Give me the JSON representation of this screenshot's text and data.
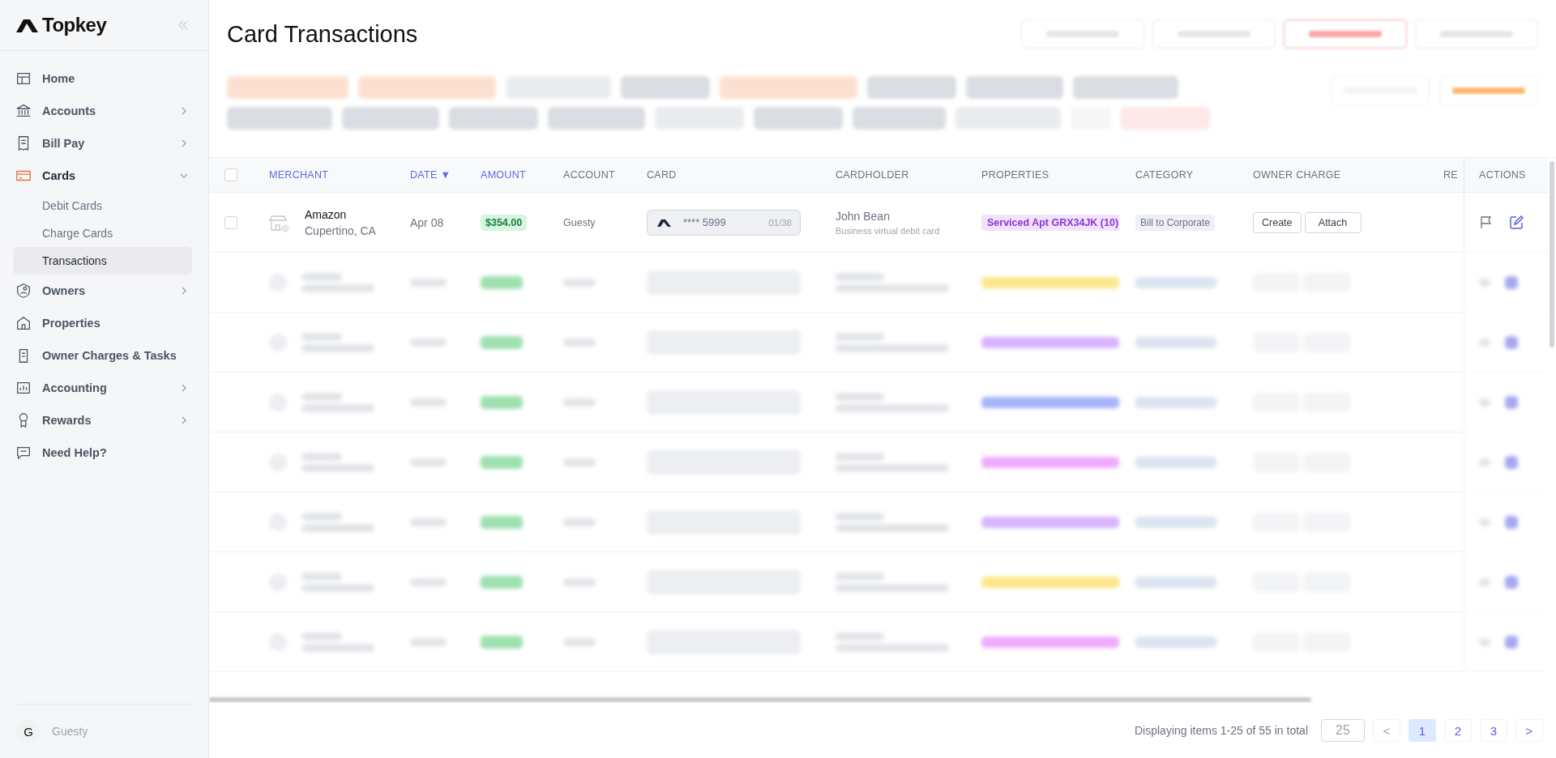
{
  "sidebar": {
    "logo": "Topkey",
    "items": [
      {
        "label": "Home",
        "active": false
      },
      {
        "label": "Accounts",
        "active": false,
        "expanded": false
      },
      {
        "label": "Bill Pay",
        "active": false,
        "expanded": false
      },
      {
        "label": "Cards",
        "active": true,
        "expanded": true,
        "children": [
          {
            "label": "Debit Cards",
            "selected": false
          },
          {
            "label": "Charge Cards",
            "selected": false
          },
          {
            "label": "Transactions",
            "selected": true
          }
        ]
      },
      {
        "label": "Owners",
        "active": false,
        "expanded": false
      },
      {
        "label": "Properties",
        "active": false
      },
      {
        "label": "Owner Charges & Tasks",
        "active": false
      },
      {
        "label": "Accounting",
        "active": false,
        "expanded": false
      },
      {
        "label": "Rewards",
        "active": false,
        "expanded": false
      },
      {
        "label": "Need Help?",
        "active": false
      }
    ],
    "account": {
      "avatar": "G",
      "name": "Guesty"
    }
  },
  "page": {
    "title": "Card Transactions",
    "header_actions": [
      {
        "color": "#e5e7eb"
      },
      {
        "color": "#e5e7eb"
      },
      {
        "color": "#fca5a5"
      },
      {
        "color": "#e5e7eb"
      }
    ],
    "filter_chips": [
      {
        "color": "#fcd9c4"
      },
      {
        "color": "#fcd9c4"
      },
      {
        "color": "#e5e7eb"
      },
      {
        "color": "#d1d5db"
      },
      {
        "color": "#fcd9c4"
      },
      {
        "color": "#d1d5db"
      },
      {
        "color": "#d1d5db"
      },
      {
        "color": "#d1d5db"
      },
      {
        "color": "#d1d5db"
      },
      {
        "color": "#d1d5db"
      },
      {
        "color": "#d1d5db"
      },
      {
        "color": "#d1d5db"
      },
      {
        "color": "#e5e7eb"
      },
      {
        "color": "#d1d5db"
      },
      {
        "color": "#d1d5db"
      },
      {
        "color": "#e5e7eb"
      },
      {
        "color": "#f3f4f6"
      },
      {
        "color": "#fde2e2"
      }
    ],
    "side_actions": [
      {
        "color": "#f3f4f6"
      },
      {
        "color": "#fdba74"
      }
    ]
  },
  "table": {
    "select_all_checked": false,
    "columns": [
      {
        "label": "MERCHANT",
        "highlighted": true
      },
      {
        "label": "DATE ▼",
        "highlighted": true
      },
      {
        "label": "AMOUNT",
        "highlighted": true
      },
      {
        "label": "ACCOUNT",
        "highlighted": false
      },
      {
        "label": "CARD",
        "highlighted": false
      },
      {
        "label": "CARDHOLDER",
        "highlighted": false
      },
      {
        "label": "PROPERTIES",
        "highlighted": false
      },
      {
        "label": "CATEGORY",
        "highlighted": false
      },
      {
        "label": "OWNER CHARGE",
        "highlighted": false
      },
      {
        "label": "RE",
        "highlighted": false
      },
      {
        "label": "ACTIONS",
        "highlighted": false
      }
    ],
    "rows": [
      {
        "kind": "plain",
        "checked": false,
        "merchant": "Amazon",
        "location": "Cupertino, CA",
        "date": "Apr 08",
        "amount": "$354.00",
        "account": "Guesty",
        "card_number": "**** 5999",
        "card_expiry": "01/38",
        "cardholder": "John Bean",
        "card_type": "Business virtual debit card",
        "property": "Serviced Apt GRX34JK (10)",
        "category": "Bill to Corporate",
        "owner_charge_buttons": [
          "Create",
          "Attach"
        ]
      },
      {
        "kind": "blurred",
        "color": "#fde68a"
      },
      {
        "kind": "blurred",
        "color": "#d8b4fe"
      },
      {
        "kind": "blurred",
        "color": "#a5b4fc"
      },
      {
        "kind": "blurred",
        "color": "#f0abfc"
      },
      {
        "kind": "blurred",
        "color": "#d8b4fe"
      },
      {
        "kind": "blurred",
        "color": "#fde68a"
      },
      {
        "kind": "blurred",
        "color": "#f0abfc"
      }
    ]
  },
  "pagination": {
    "summary": "Displaying items 1-25 of 55 in total",
    "page_size": "25",
    "prev": {
      "label": "<",
      "disabled": true
    },
    "pages": [
      {
        "label": "1",
        "selected": true
      },
      {
        "label": "2",
        "selected": false
      },
      {
        "label": "3",
        "selected": false
      }
    ],
    "next": {
      "label": ">",
      "disabled": false
    }
  }
}
